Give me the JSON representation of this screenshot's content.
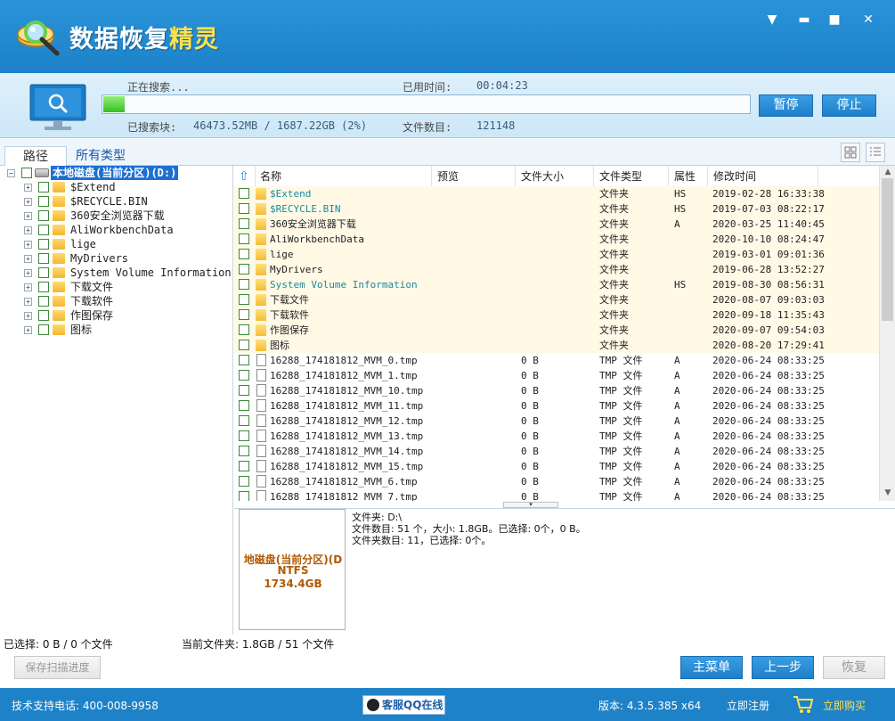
{
  "window": {
    "title_part1": "数据恢复",
    "title_part2": "精灵",
    "controls": {
      "menu": "▼",
      "minimize": "▬",
      "maximize": "■",
      "close": "✕"
    }
  },
  "scan": {
    "status_label": "正在搜索...",
    "elapsed_label": "已用时间:",
    "elapsed_value": "00:04:23",
    "progress_fraction": 0.02,
    "searched_label": "已搜索块:",
    "searched_value": "46473.52MB / 1687.22GB (2%)",
    "file_count_label": "文件数目:",
    "file_count_value": "121148",
    "pause_button": "暂停",
    "stop_button": "停止"
  },
  "tabs": {
    "path": "路径",
    "all_types": "所有类型"
  },
  "tree": {
    "root": "本地磁盘(当前分区)(D:)",
    "items": [
      "$Extend",
      "$RECYCLE.BIN",
      "360安全浏览器下载",
      "AliWorkbenchData",
      "lige",
      "MyDrivers",
      "System Volume Information",
      "下载文件",
      "下载软件",
      "作图保存",
      "图标"
    ]
  },
  "list": {
    "up_arrow": "⇧",
    "columns": [
      "名称",
      "预览",
      "文件大小",
      "文件类型",
      "属性",
      "修改时间"
    ],
    "rows": [
      {
        "name": "$Extend",
        "size": "",
        "type": "文件夹",
        "attr": "HS",
        "mtime": "2019-02-28 16:33:38",
        "kind": "folder",
        "style": "cyan"
      },
      {
        "name": "$RECYCLE.BIN",
        "size": "",
        "type": "文件夹",
        "attr": "HS",
        "mtime": "2019-07-03 08:22:17",
        "kind": "folder",
        "style": "cyan"
      },
      {
        "name": "360安全浏览器下载",
        "size": "",
        "type": "文件夹",
        "attr": "A",
        "mtime": "2020-03-25 11:40:45",
        "kind": "folder",
        "style": ""
      },
      {
        "name": "AliWorkbenchData",
        "size": "",
        "type": "文件夹",
        "attr": "",
        "mtime": "2020-10-10 08:24:47",
        "kind": "folder",
        "style": ""
      },
      {
        "name": "lige",
        "size": "",
        "type": "文件夹",
        "attr": "",
        "mtime": "2019-03-01 09:01:36",
        "kind": "folder",
        "style": ""
      },
      {
        "name": "MyDrivers",
        "size": "",
        "type": "文件夹",
        "attr": "",
        "mtime": "2019-06-28 13:52:27",
        "kind": "folder",
        "style": ""
      },
      {
        "name": "System Volume Information",
        "size": "",
        "type": "文件夹",
        "attr": "HS",
        "mtime": "2019-08-30 08:56:31",
        "kind": "folder",
        "style": "cyan"
      },
      {
        "name": "下载文件",
        "size": "",
        "type": "文件夹",
        "attr": "",
        "mtime": "2020-08-07 09:03:03",
        "kind": "folder",
        "style": ""
      },
      {
        "name": "下载软件",
        "size": "",
        "type": "文件夹",
        "attr": "",
        "mtime": "2020-09-18 11:35:43",
        "kind": "folder",
        "style": ""
      },
      {
        "name": "作图保存",
        "size": "",
        "type": "文件夹",
        "attr": "",
        "mtime": "2020-09-07 09:54:03",
        "kind": "folder",
        "style": ""
      },
      {
        "name": "图标",
        "size": "",
        "type": "文件夹",
        "attr": "",
        "mtime": "2020-08-20 17:29:41",
        "kind": "folder",
        "style": ""
      },
      {
        "name": "16288_174181812_MVM_0.tmp",
        "size": "0 B",
        "type": "TMP 文件",
        "attr": "A",
        "mtime": "2020-06-24 08:33:25",
        "kind": "file",
        "style": ""
      },
      {
        "name": "16288_174181812_MVM_1.tmp",
        "size": "0 B",
        "type": "TMP 文件",
        "attr": "A",
        "mtime": "2020-06-24 08:33:25",
        "kind": "file",
        "style": ""
      },
      {
        "name": "16288_174181812_MVM_10.tmp",
        "size": "0 B",
        "type": "TMP 文件",
        "attr": "A",
        "mtime": "2020-06-24 08:33:25",
        "kind": "file",
        "style": ""
      },
      {
        "name": "16288_174181812_MVM_11.tmp",
        "size": "0 B",
        "type": "TMP 文件",
        "attr": "A",
        "mtime": "2020-06-24 08:33:25",
        "kind": "file",
        "style": ""
      },
      {
        "name": "16288_174181812_MVM_12.tmp",
        "size": "0 B",
        "type": "TMP 文件",
        "attr": "A",
        "mtime": "2020-06-24 08:33:25",
        "kind": "file",
        "style": ""
      },
      {
        "name": "16288_174181812_MVM_13.tmp",
        "size": "0 B",
        "type": "TMP 文件",
        "attr": "A",
        "mtime": "2020-06-24 08:33:25",
        "kind": "file",
        "style": ""
      },
      {
        "name": "16288_174181812_MVM_14.tmp",
        "size": "0 B",
        "type": "TMP 文件",
        "attr": "A",
        "mtime": "2020-06-24 08:33:25",
        "kind": "file",
        "style": ""
      },
      {
        "name": "16288_174181812_MVM_15.tmp",
        "size": "0 B",
        "type": "TMP 文件",
        "attr": "A",
        "mtime": "2020-06-24 08:33:25",
        "kind": "file",
        "style": ""
      },
      {
        "name": "16288_174181812_MVM_6.tmp",
        "size": "0 B",
        "type": "TMP 文件",
        "attr": "A",
        "mtime": "2020-06-24 08:33:25",
        "kind": "file",
        "style": ""
      },
      {
        "name": "16288_174181812_MVM_7.tmp",
        "size": "0 B",
        "type": "TMP 文件",
        "attr": "A",
        "mtime": "2020-06-24 08:33:25",
        "kind": "file",
        "style": ""
      }
    ]
  },
  "preview": {
    "drive_name": "地磁盘(当前分区)(D",
    "filesystem": "NTFS",
    "capacity": "1734.4GB",
    "line1": "文件夹: D:\\",
    "line2": "文件数目: 51 个，大小: 1.8GB。已选择: 0个，0 B。",
    "line3": "文件夹数目: 11，已选择: 0个。"
  },
  "status": {
    "selected": "已选择: 0 B / 0 个文件",
    "current_folder": "当前文件夹: 1.8GB / 51 个文件"
  },
  "buttons": {
    "save_progress": "保存扫描进度",
    "main_menu": "主菜单",
    "prev_step": "上一步",
    "recover": "恢复"
  },
  "footer": {
    "support": "技术支持电话: 400-008-9958",
    "qq": "客服QQ在线",
    "version": "版本: 4.3.5.385 x64",
    "register": "立即注册",
    "buy": "立即购买"
  },
  "colors": {
    "brand_blue": "#1e82c8",
    "accent_yellow": "#ffe34d",
    "progress_green": "#34c01e"
  },
  "icons": [
    "magnifier-logo-icon",
    "monitor-search-icon",
    "drive-icon",
    "folder-icon",
    "file-icon",
    "cart-icon",
    "qq-penguin-icon",
    "grid-view-icon",
    "list-view-icon"
  ]
}
